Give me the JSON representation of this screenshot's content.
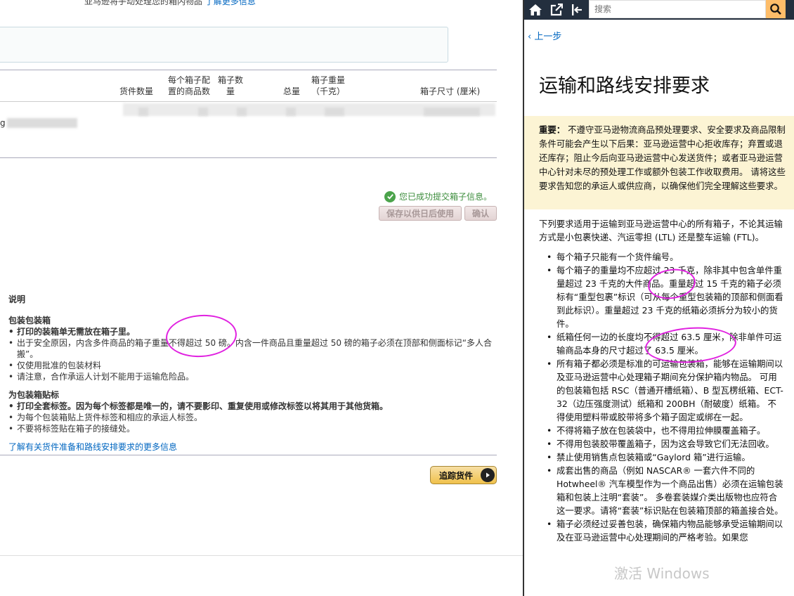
{
  "main": {
    "top_note": "亚马逊将手动处理您的箱内物品",
    "top_note_link": "了解更多信息",
    "table_headers": {
      "units": "货件数量",
      "per_box_line1": "每个箱子配",
      "per_box_line2": "置的商品数",
      "box_count_line1": "箱子数",
      "box_count_line2": "量",
      "total": "总量",
      "weight_line1": "箱子重量",
      "weight_line2": "（千克）",
      "dimensions": "箱子尺寸 (厘米)"
    },
    "row_prefix": "g",
    "success_message": "您已成功提交箱子信息。",
    "save_later_button": "保存以供日后使用",
    "confirm_button": "确认",
    "instructions": {
      "heading": "说明",
      "packing_heading": "包装包装箱",
      "packing_items": [
        "打印的装箱单无需放在箱子里。",
        "出于安全原因，内含多件商品的箱子重量不得超过 50 磅。内含一件商品且重量超过 50 磅的箱子必须在顶部和侧面标记“多人合搬”。",
        "仅使用批准的包装材料",
        "请注意，合作承运人计划不能用于运输危险品。"
      ],
      "labeling_heading": "为包装箱贴标",
      "labeling_items": [
        "打印全套标签。因为每个标签都是唯一的，请不要影印、重复使用或修改标签以将其用于其他货箱。",
        "为每个包装箱贴上货件标签和相应的承运人标签。",
        "不要将标签贴在箱子的接缝处。"
      ],
      "learn_more": "了解有关货件准备和路线安排要求的更多信息"
    },
    "track_button": "追踪货件"
  },
  "help": {
    "search_placeholder": "搜索",
    "back_link": "上一步",
    "title": "运输和路线安排要求",
    "alert_label": "重要：",
    "alert_text": "不遵守亚马逊物流商品预处理要求、安全要求及商品限制条件可能会产生以下后果：亚马逊运营中心拒收库存；弃置或退还库存；阻止今后向亚马逊运营中心发送货件；或者亚马逊运营中心针对未尽的预处理工作或额外包装工作收取费用。 请将这些要求告知您的承运人或供应商，以确保他们完全理解这些要求。",
    "intro": "下列要求适用于运输到亚马逊运营中心的所有箱子，不论其运输方式是小包裹快递、汽运零担 (LTL) 还是整车运输 (FTL)。",
    "items": [
      "每个箱子只能有一个货件编号。",
      "每个箱子的重量均不应超过 23 千克，除非其中包含单件重量超过 23 千克的大件商品。重量超过 15 千克的箱子必须标有“重型包裹”标识（可从每个重型包装箱的顶部和侧面看到此标识）。重量超过 23 千克的纸箱必须拆分为较小的货件。",
      "纸箱任何一边的长度均不得超过 63.5 厘米，除非单件可运输商品本身的尺寸超过了 63.5 厘米。",
      "所有箱子都必须是标准的可运输包装箱，能够在运输期间以及亚马逊运营中心处理箱子期间充分保护箱内物品。 可用的包装箱包括 RSC（普通开槽纸箱）、B 型瓦楞纸箱、ECT-32（边压强度测试）纸箱和 200BH（耐破度）纸箱。 不得使用塑料带或胶带将多个箱子固定或绑在一起。",
      "不得将箱子放在包装袋中，也不得用拉伸膜覆盖箱子。",
      "不得用包装胶带覆盖箱子，因为这会导致它们无法回收。",
      "禁止使用销售点包装箱或“Gaylord 箱”进行运输。",
      "成套出售的商品（例如 NASCAR® 一套六件不同的 Hotwheel® 汽车模型作为一个商品出售）必须在运输包装箱和包装上注明“套装”。 多卷套装媒介类出版物也应符合这一要求。请将“套装”标识贴在包装箱顶部的箱盖接合处。",
      "箱子必须经过妥善包装，确保箱内物品能够承受运输期间以及在亚马逊运营中心处理期间的严格考验。如果您"
    ],
    "watermark": "激活 Windows"
  }
}
